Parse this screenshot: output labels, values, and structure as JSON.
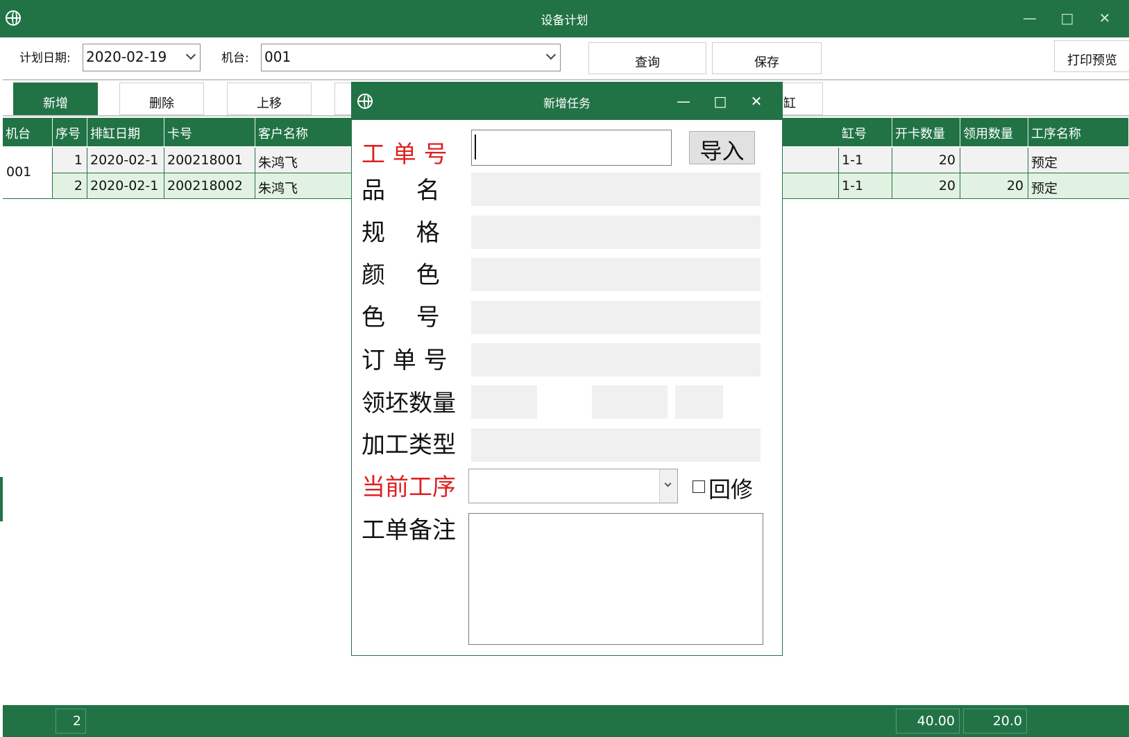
{
  "window": {
    "title": "设备计划"
  },
  "toolbar": {
    "plan_date_label": "计划日期:",
    "plan_date_value": "2020-02-19",
    "machine_label": "机台:",
    "machine_value": "001",
    "query_label": "查询",
    "save_label": "保存",
    "print_preview_label": "打印预览"
  },
  "actions": {
    "add_label": "新增",
    "delete_label": "删除",
    "move_up_label": "上移",
    "partial_label": "缸"
  },
  "grid": {
    "columns": [
      "机台",
      "序号",
      "排缸日期",
      "卡号",
      "客户名称",
      "缸号",
      "开卡数量",
      "领用数量",
      "工序名称"
    ],
    "machine_group": "001",
    "rows": [
      {
        "seq": "1",
        "date": "2020-02-1",
        "card": "200218001",
        "customer": "朱鸿飞",
        "vat": "1-1",
        "open_qty": "20",
        "used_qty": "",
        "process": "预定"
      },
      {
        "seq": "2",
        "date": "2020-02-1",
        "card": "200218002",
        "customer": "朱鸿飞",
        "vat": "1-1",
        "open_qty": "20",
        "used_qty": "20",
        "process": "预定"
      }
    ]
  },
  "status": {
    "count": "2",
    "open_total": "40.00",
    "used_total": "20.0"
  },
  "dialog": {
    "title": "新增任务",
    "fields": {
      "work_order": "工 单 号",
      "product_name": "品　 名",
      "spec": "规　 格",
      "color": "颜　 色",
      "color_no": "色　 号",
      "order_no": "订 单 号",
      "grey_qty": "领坯数量",
      "process_type": "加工类型",
      "current_process": "当前工序",
      "remark": "工单备注"
    },
    "import_label": "导入",
    "rework_label": "回修"
  },
  "colors": {
    "brand": "#217346",
    "required_label": "#e02020"
  }
}
